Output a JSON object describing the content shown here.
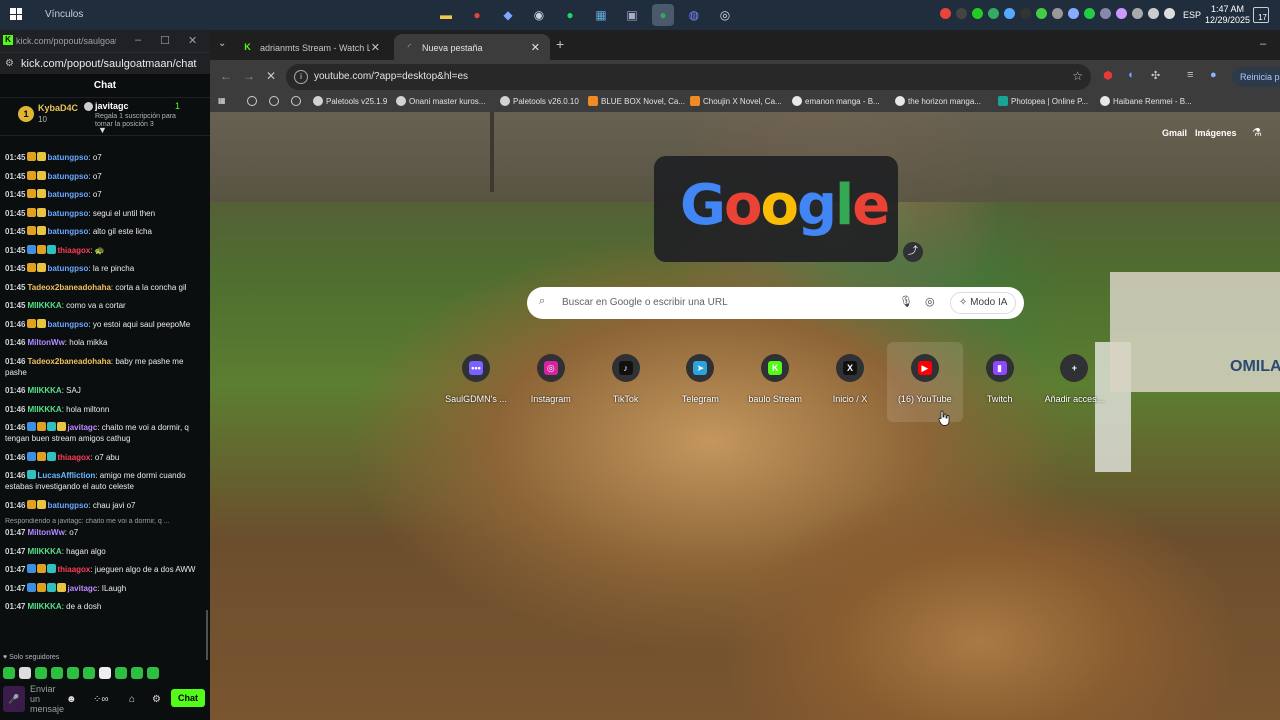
{
  "taskbar": {
    "search_label": "Vínculos",
    "language": "ESP",
    "time": "1:47 AM",
    "date": "12/29/2025",
    "notif_count": "17",
    "pinned_apps": [
      "file-explorer-icon",
      "chrome-icon",
      "copilot-icon",
      "steam-icon",
      "spotify-icon",
      "store-icon",
      "photos-icon",
      "chrome-active-icon",
      "discord-icon",
      "obs-icon"
    ]
  },
  "kick": {
    "window_title": "kick.com/popout/saulgoat...",
    "address": "kick.com/popout/saulgoatmaan/chat",
    "chat_header": "Chat",
    "pinned": {
      "rank": "1",
      "name": "KybaD4C",
      "count": "10",
      "gifter": "javitagc",
      "gifter_count": "1",
      "gift_text": "Regala 1 suscripción para tomar la posición 3"
    },
    "messages": [
      {
        "time": "01:45",
        "user": "batungpso",
        "color": "#6ba7ff",
        "text": "o7",
        "badges": [
          "#e0a020",
          "#e8c440"
        ]
      },
      {
        "time": "01:45",
        "user": "batungpso",
        "color": "#6ba7ff",
        "text": "o7",
        "badges": [
          "#e0a020",
          "#e8c440"
        ]
      },
      {
        "time": "01:45",
        "user": "batungpso",
        "color": "#6ba7ff",
        "text": "o7",
        "badges": [
          "#e0a020",
          "#e8c440"
        ]
      },
      {
        "time": "01:45",
        "user": "batungpso",
        "color": "#6ba7ff",
        "text": "segui el until then",
        "badges": [
          "#e0a020",
          "#e8c440"
        ]
      },
      {
        "time": "01:45",
        "user": "batungpso",
        "color": "#6ba7ff",
        "text": "alto gil este licha",
        "badges": [
          "#e0a020",
          "#e8c440"
        ]
      },
      {
        "time": "01:45",
        "user": "thiaagox",
        "color": "#ff3b5c",
        "text": "",
        "badges": [
          "#3d8fe0",
          "#e0a020",
          "#30c0c0"
        ]
      },
      {
        "time": "01:45",
        "user": "batungpso",
        "color": "#6ba7ff",
        "text": "la re pincha",
        "badges": [
          "#e0a020",
          "#e8c440"
        ]
      },
      {
        "time": "01:45",
        "user": "Tadeox2baneadohaha",
        "color": "#f0c060",
        "text": "corta a la concha gil",
        "badges": []
      },
      {
        "time": "01:45",
        "user": "MIIKKKA",
        "color": "#56e08a",
        "text": "como va a cortar",
        "badges": []
      },
      {
        "time": "01:46",
        "user": "batungpso",
        "color": "#6ba7ff",
        "text": "yo estoi aqui saul peepoMe",
        "badges": [
          "#e0a020",
          "#e8c440"
        ]
      },
      {
        "time": "01:46",
        "user": "MiltonWw",
        "color": "#b48bff",
        "text": "hola mikka",
        "badges": []
      },
      {
        "time": "01:46",
        "user": "Tadeox2baneadohaha",
        "color": "#f0c060",
        "text": "baby me pashe me pashe",
        "badges": []
      },
      {
        "time": "01:46",
        "user": "MIIKKKA",
        "color": "#56e08a",
        "text": "SAJ",
        "badges": []
      },
      {
        "time": "01:46",
        "user": "MIIKKKA",
        "color": "#56e08a",
        "text": "hola miltonn",
        "badges": []
      },
      {
        "time": "01:46",
        "user": "javitagc",
        "color": "#c08bff",
        "text": "chaito me voi a dormir, q tengan buen stream amigos cathug",
        "badges": [
          "#3d8fe0",
          "#e0a020",
          "#30c0c0",
          "#e8c440"
        ]
      },
      {
        "time": "01:46",
        "user": "thiaagox",
        "color": "#ff3b5c",
        "text": "o7 abu",
        "badges": [
          "#3d8fe0",
          "#e0a020",
          "#30c0c0"
        ]
      },
      {
        "time": "01:46",
        "user": "LucasAffliction",
        "color": "#6ab8ff",
        "text": "amigo me dormi cuando estabas investigando el auto celeste",
        "badges": [
          "#30c0c0"
        ]
      },
      {
        "time": "01:46",
        "user": "batungpso",
        "color": "#6ba7ff",
        "text": "chau javi o7",
        "badges": [
          "#e0a020",
          "#e8c440"
        ]
      }
    ],
    "reply_text": "Respondiendo a javitagc: chaito me voi a dormir, q ...",
    "messages2": [
      {
        "time": "01:47",
        "user": "MiltonWw",
        "color": "#b48bff",
        "text": "o7",
        "badges": []
      },
      {
        "time": "01:47",
        "user": "MIIKKKA",
        "color": "#56e08a",
        "text": "hagan algo",
        "badges": []
      },
      {
        "time": "01:47",
        "user": "thiaagox",
        "color": "#ff3b5c",
        "text": "jueguen algo de a dos AWW",
        "badges": [
          "#3d8fe0",
          "#e0a020",
          "#30c0c0"
        ]
      },
      {
        "time": "01:47",
        "user": "javitagc",
        "color": "#c08bff",
        "text": "ILaugh",
        "badges": [
          "#3d8fe0",
          "#e0a020",
          "#30c0c0",
          "#e8c440"
        ]
      },
      {
        "time": "01:47",
        "user": "MIIKKKA",
        "color": "#56e08a",
        "text": "de a dosh",
        "badges": []
      }
    ],
    "followers_only": "Solo seguidores",
    "input_placeholder": "Enviar un mensaje",
    "infinity_label": "∞",
    "chat_button": "Chat"
  },
  "chrome": {
    "tabs": [
      {
        "label": "adrianmts Stream - Watch Live",
        "active": false
      },
      {
        "label": "Nueva pestaña",
        "active": true
      }
    ],
    "url": "youtube.com/?app=desktop&hl=es",
    "relaunch_label": "Reinicia par",
    "bookmarks": [
      {
        "label": "Paletools v25.1.9",
        "color": "#cfd3d6"
      },
      {
        "label": "Onani master kuros...",
        "color": "#cfd3d6"
      },
      {
        "label": "Paletools v26.0.10",
        "color": "#cfd3d6"
      },
      {
        "label": "BLUE BOX Novel, Ca...",
        "color": "#f08a24"
      },
      {
        "label": "Choujin X Novel, Ca...",
        "color": "#f08a24"
      },
      {
        "label": "emanon manga - B...",
        "color": "#e8e8e8"
      },
      {
        "label": "the horizon manga...",
        "color": "#e8e8e8"
      },
      {
        "label": "Photopea | Online P...",
        "color": "#18a497"
      },
      {
        "label": "Haibane Renmei - B...",
        "color": "#e8e8e8"
      }
    ]
  },
  "ntp": {
    "gmail": "Gmail",
    "images": "Imágenes",
    "search_placeholder": "Buscar en Google o escribir una URL",
    "ai_mode": "Modo IA",
    "crate_text": "OMILA",
    "doodle_letters": [
      "G",
      "o",
      "o",
      "g",
      "l",
      "e"
    ],
    "doodle_colors": [
      "#4285f4",
      "#ea4335",
      "#fbbc05",
      "#4285f4",
      "#34a853",
      "#ea4335"
    ],
    "shortcuts": [
      {
        "label": "SaulGDMN's ...",
        "color": "#7b61ff",
        "glyph": "•••",
        "hover": false
      },
      {
        "label": "Instagram",
        "color": "#d6249f",
        "glyph": "◎",
        "hover": false
      },
      {
        "label": "TikTok",
        "color": "#111111",
        "glyph": "♪",
        "hover": false
      },
      {
        "label": "Telegram",
        "color": "#2aa3de",
        "glyph": "➤",
        "hover": false
      },
      {
        "label": "baulo Stream",
        "color": "#53fc18",
        "glyph": "K",
        "hover": false
      },
      {
        "label": "Inicio / X",
        "color": "#111111",
        "glyph": "X",
        "hover": false
      },
      {
        "label": "(16) YouTube",
        "color": "#ff0000",
        "glyph": "▶",
        "hover": true
      },
      {
        "label": "Twitch",
        "color": "#9146ff",
        "glyph": "▮",
        "hover": false
      },
      {
        "label": "Añadir acces...",
        "color": "#303134",
        "glyph": "+",
        "hover": false
      }
    ]
  }
}
